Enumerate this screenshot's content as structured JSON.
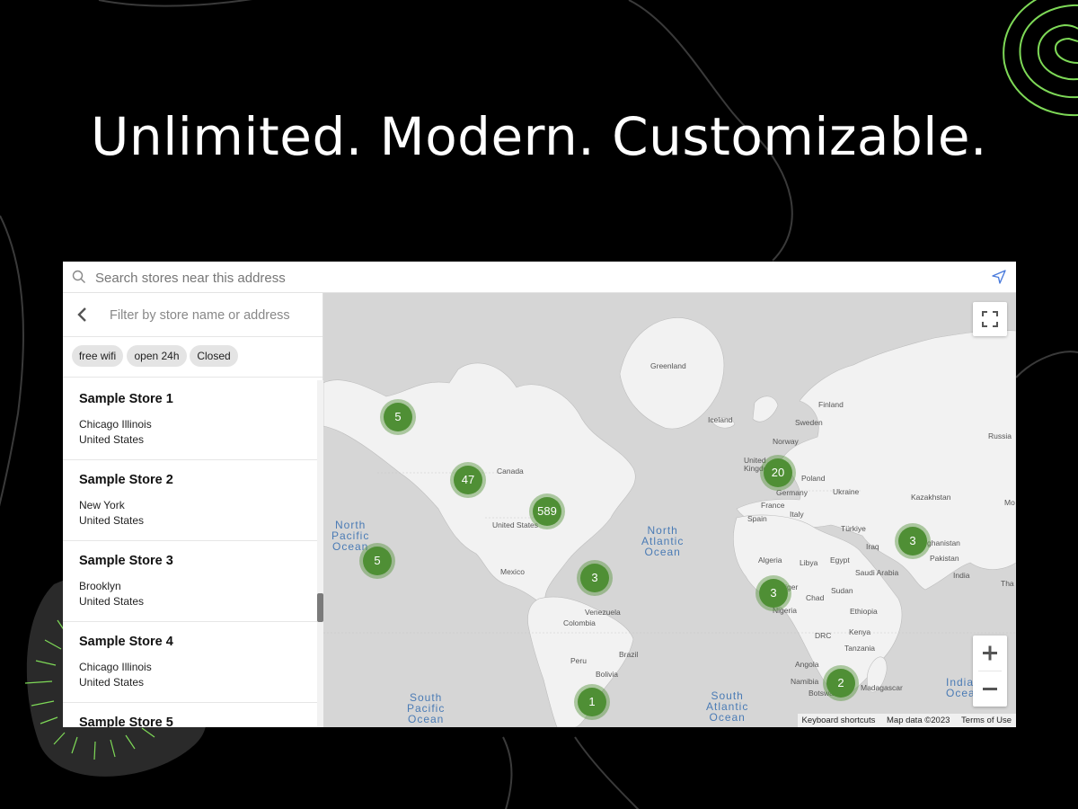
{
  "headline": "Unlimited. Modern. Customizable.",
  "colors": {
    "cluster": "#4f8f35",
    "ocean_text": "#4a7bb5",
    "accent_line": "#7ed957"
  },
  "search": {
    "placeholder": "Search stores near this address",
    "icon": "search-icon",
    "locate_icon": "navigation-arrow-icon"
  },
  "sidebar": {
    "filter_placeholder": "Filter by store name or address",
    "back_icon": "chevron-left-icon",
    "tags": [
      "free wifi",
      "open 24h",
      "Closed"
    ],
    "stores": [
      {
        "name": "Sample Store 1",
        "city": "Chicago Illinois",
        "country": "United States"
      },
      {
        "name": "Sample Store 2",
        "city": "New York",
        "country": "United States"
      },
      {
        "name": "Sample Store 3",
        "city": "Brooklyn",
        "country": "United States"
      },
      {
        "name": "Sample Store 4",
        "city": "Chicago Illinois",
        "country": "United States"
      },
      {
        "name": "Sample Store 5",
        "city": "",
        "country": ""
      }
    ]
  },
  "map": {
    "clusters": [
      "5",
      "47",
      "589",
      "5",
      "3",
      "1",
      "20",
      "3",
      "3",
      "2"
    ],
    "labels": [
      "Greenland",
      "Iceland",
      "Finland",
      "Sweden",
      "Norway",
      "United Kingdom",
      "Poland",
      "Germany",
      "Ukraine",
      "Kazakhstan",
      "Russia",
      "France",
      "Italy",
      "Spain",
      "Türkiye",
      "Iraq",
      "Afghanistan",
      "Pakistan",
      "India",
      "Algeria",
      "Libya",
      "Egypt",
      "Saudi Arabia",
      "Niger",
      "Chad",
      "Sudan",
      "Nigeria",
      "Ethiopia",
      "Kenya",
      "DRC",
      "Tanzania",
      "Angola",
      "Namibia",
      "Botswana",
      "Madagascar",
      "Canada",
      "United States",
      "Mexico",
      "Venezuela",
      "Colombia",
      "Brazil",
      "Peru",
      "Bolivia",
      "Mo",
      "Tha"
    ],
    "oceans": [
      "North\nPacific\nOcean",
      "North\nAtlantic\nOcean",
      "South\nPacific\nOcean",
      "South\nAtlantic\nOcean",
      "India\nOcea"
    ],
    "attribution": [
      "Keyboard shortcuts",
      "Map data ©2023",
      "Terms of Use"
    ],
    "controls": {
      "fullscreen_icon": "fullscreen-icon",
      "zoom_in_icon": "plus-icon",
      "zoom_out_icon": "minus-icon"
    }
  }
}
